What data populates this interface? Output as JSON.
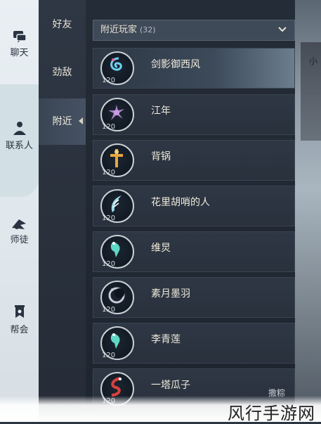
{
  "sidebar": {
    "items": [
      {
        "label": "聊天",
        "icon": "chat-bubble-icon"
      },
      {
        "label": "联系人",
        "icon": "contacts-icon"
      },
      {
        "label": "师徒",
        "icon": "mentor-icon"
      },
      {
        "label": "帮会",
        "icon": "guild-banner-icon"
      }
    ]
  },
  "tabs": [
    {
      "label": "好友"
    },
    {
      "label": "劲敌"
    },
    {
      "label": "附近"
    }
  ],
  "dropdown": {
    "label": "附近玩家",
    "count": "(32)"
  },
  "players": [
    {
      "name": "剑影御西风",
      "level": "120",
      "icon": "swirl-emblem-icon",
      "color": "#6fd0f0"
    },
    {
      "name": "江年",
      "level": "120",
      "icon": "flower-emblem-icon",
      "color": "#c99be6"
    },
    {
      "name": "背锅",
      "level": "120",
      "icon": "sword-emblem-icon",
      "color": "#e8a640"
    },
    {
      "name": "花里胡哨的人",
      "level": "120",
      "icon": "feather-emblem-icon",
      "color": "#9fd8e8"
    },
    {
      "name": "维炅",
      "level": "120",
      "icon": "crane-emblem-icon",
      "color": "#5fd8c6"
    },
    {
      "name": "素月墨羽",
      "level": "120",
      "icon": "moon-emblem-icon",
      "color": "#c6cbd6"
    },
    {
      "name": "李青莲",
      "level": "120",
      "icon": "crane-emblem-icon",
      "color": "#5fd8c6"
    },
    {
      "name": "一塔瓜子",
      "level": "120",
      "icon": "serpent-emblem-icon",
      "color": "#d84040"
    }
  ],
  "side_text": "小",
  "bottom_button": "撒粽",
  "watermark": "风行手游网",
  "colors": {
    "panel": "#242c37",
    "accent_tab": "#465263",
    "sidebar": "#e9eff3"
  }
}
